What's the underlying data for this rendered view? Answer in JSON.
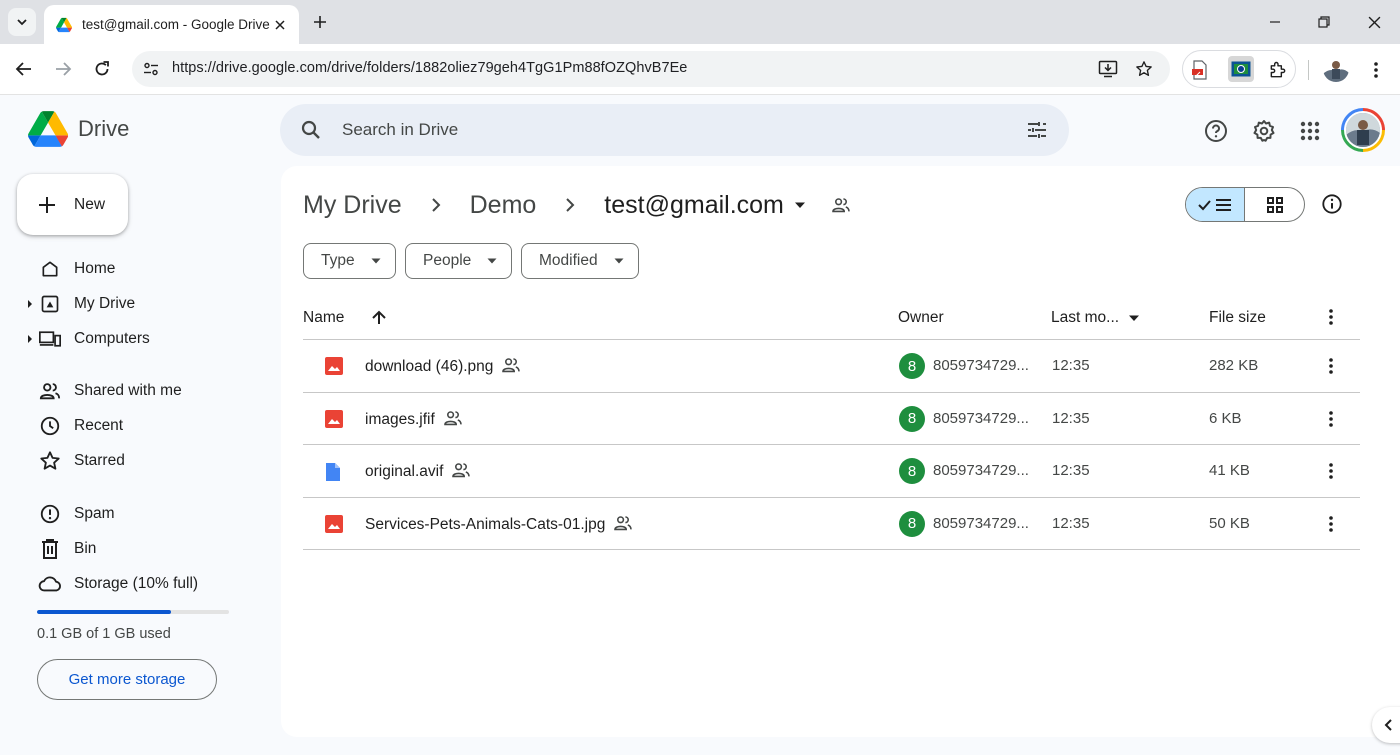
{
  "browser": {
    "tab_title": "test@gmail.com - Google Drive",
    "url": "https://drive.google.com/drive/folders/1882oliez79geh4TgG1Pm88fOZQhvB7Ee",
    "icons": [
      "tab-search-icon",
      "drive-favicon",
      "close-icon",
      "plus-icon",
      "minimize-icon",
      "restore-icon",
      "close-window-icon",
      "back-icon",
      "forward-icon",
      "reload-icon",
      "site-info-icon",
      "install-icon",
      "star-icon",
      "pdf-extension-icon",
      "screenshot-extension-icon",
      "extensions-icon",
      "profile-icon",
      "more-vert-icon"
    ]
  },
  "header": {
    "app_name": "Drive",
    "search_placeholder": "Search in Drive",
    "icons": [
      "help-icon",
      "settings-icon",
      "apps-icon",
      "account-avatar"
    ]
  },
  "sidebar": {
    "new_label": "New",
    "items": [
      {
        "label": "Home",
        "icon": "home-icon"
      },
      {
        "label": "My Drive",
        "icon": "my-drive-icon",
        "expandable": true
      },
      {
        "label": "Computers",
        "icon": "computers-icon",
        "expandable": true
      },
      {
        "label": "Shared with me",
        "icon": "shared-icon"
      },
      {
        "label": "Recent",
        "icon": "clock-icon"
      },
      {
        "label": "Starred",
        "icon": "star-icon"
      },
      {
        "label": "Spam",
        "icon": "spam-icon"
      },
      {
        "label": "Bin",
        "icon": "bin-icon"
      },
      {
        "label": "Storage (10% full)",
        "icon": "cloud-icon"
      }
    ],
    "storage_percent": 0.7,
    "storage_used": "0.1 GB of 1 GB used",
    "get_storage_label": "Get more storage"
  },
  "main": {
    "breadcrumbs": [
      "My Drive",
      "Demo",
      "test@gmail.com"
    ],
    "filters": [
      "Type",
      "People",
      "Modified"
    ],
    "columns": {
      "name": "Name",
      "owner": "Owner",
      "modified": "Last mo...",
      "size": "File size"
    },
    "files": [
      {
        "name": "download (46).png",
        "type": "image",
        "owner_initial": "8",
        "owner": "8059734729...",
        "modified": "12:35",
        "size": "282 KB"
      },
      {
        "name": "images.jfif",
        "type": "image",
        "owner_initial": "8",
        "owner": "8059734729...",
        "modified": "12:35",
        "size": "6 KB"
      },
      {
        "name": "original.avif",
        "type": "doc",
        "owner_initial": "8",
        "owner": "8059734729...",
        "modified": "12:35",
        "size": "41 KB"
      },
      {
        "name": "Services-Pets-Animals-Cats-01.jpg",
        "type": "image",
        "owner_initial": "8",
        "owner": "8059734729...",
        "modified": "12:35",
        "size": "50 KB"
      }
    ]
  },
  "colors": {
    "accent": "#0b57d0",
    "selected_view": "#c2e7ff",
    "image_icon": "#ea4335",
    "doc_icon": "#4285f4",
    "owner_avatar": "#1e8e3e"
  }
}
